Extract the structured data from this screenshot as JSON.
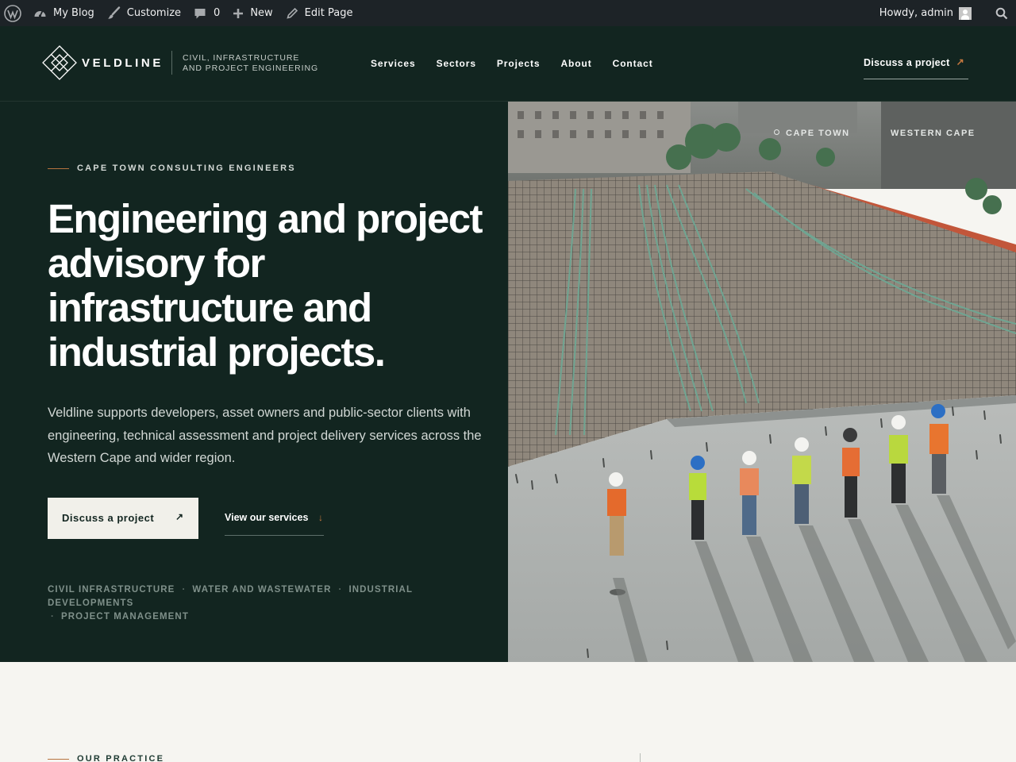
{
  "admin_bar": {
    "site_name": "My Blog",
    "customize": "Customize",
    "comments_count": "0",
    "new": "New",
    "edit_page": "Edit Page",
    "greeting": "Howdy, admin"
  },
  "header": {
    "brand": "VELDLINE",
    "tagline_line1": "CIVIL, INFRASTRUCTURE",
    "tagline_line2": "AND PROJECT ENGINEERING",
    "nav": [
      "Services",
      "Sectors",
      "Projects",
      "About",
      "Contact"
    ],
    "cta": "Discuss a project",
    "cta_arrow": "↗"
  },
  "hero": {
    "eyebrow": "CAPE TOWN CONSULTING ENGINEERS",
    "headline": "Engineering and project advisory for infrastructure and industrial projects.",
    "lede": "Veldline supports developers, asset owners and public-sector clients with engineering, technical assessment and project delivery services across the Western Cape and wider region.",
    "primary_button": "Discuss a project",
    "primary_arrow": "↗",
    "secondary_button": "View our services",
    "secondary_arrow": "↓",
    "tags": [
      "CIVIL INFRASTRUCTURE",
      "WATER AND WASTEWATER",
      "INDUSTRIAL DEVELOPMENTS",
      "PROJECT MANAGEMENT"
    ],
    "tag_separator": "·",
    "location_1": "CAPE TOWN",
    "location_2": "WESTERN CAPE"
  },
  "practice": {
    "eyebrow": "OUR PRACTICE"
  },
  "colors": {
    "dark_green": "#122520",
    "accent_copper": "#b6733f",
    "admin_bar": "#1d2327",
    "cream": "#f6f5f1"
  }
}
